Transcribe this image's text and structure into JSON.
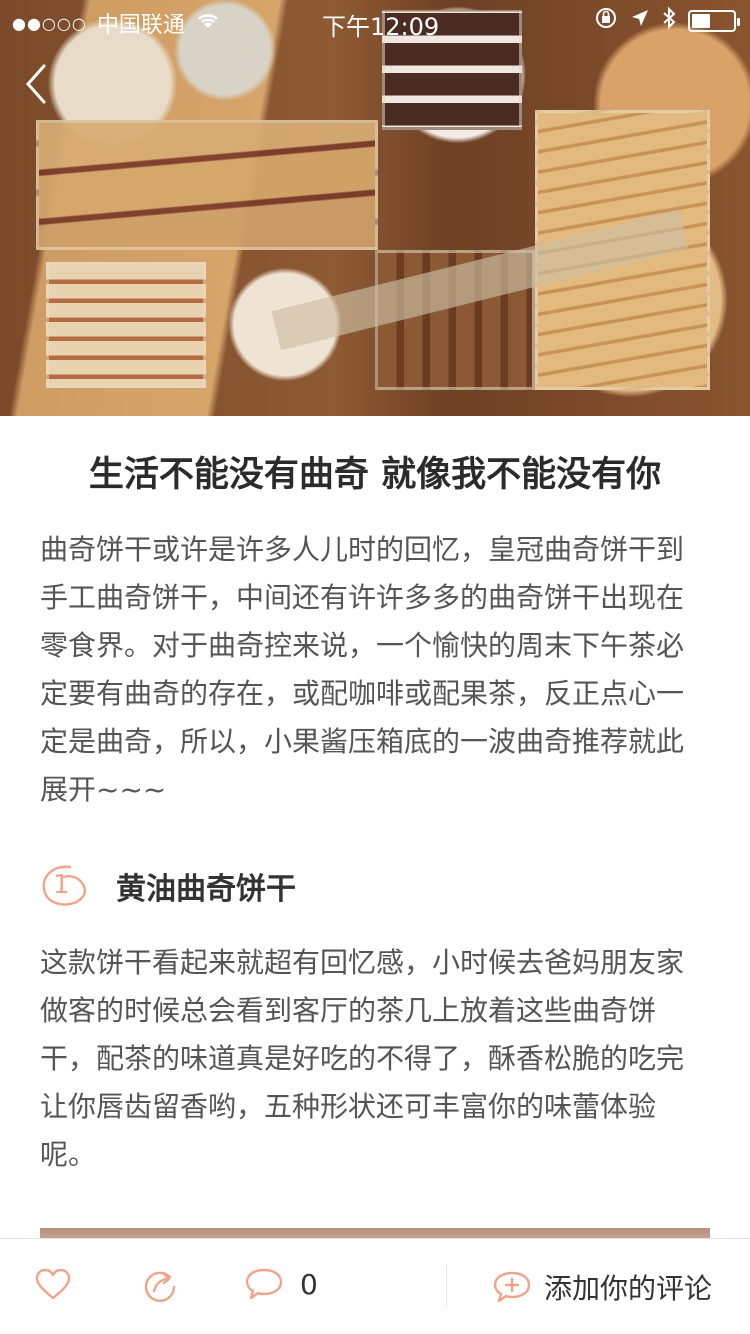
{
  "status_bar": {
    "signal": "●●○○○",
    "carrier": "中国联通",
    "time": "下午12:09",
    "battery_level": 0.45
  },
  "article": {
    "title": "生活不能没有曲奇 就像我不能没有你",
    "intro": "曲奇饼干或许是许多人儿时的回忆，皇冠曲奇饼干到手工曲奇饼干，中间还有许许多多的曲奇饼干出现在零食界。对于曲奇控来说，一个愉快的周末下午茶必定要有曲奇的存在，或配咖啡或配果茶，反正点心一定是曲奇，所以，小果酱压箱底的一波曲奇推荐就此展开~~~",
    "section_1": {
      "number": "1",
      "heading": "黄油曲奇饼干",
      "body": "这款饼干看起来就超有回忆感，小时候去爸妈朋友家做客的时候总会看到客厅的茶几上放着这些曲奇饼干，配茶的味道真是好吃的不得了，酥香松脆的吃完让你唇齿留香哟，五种形状还可丰富你的味蕾体验呢。"
    }
  },
  "toolbar": {
    "comment_count": "0",
    "add_comment_label": "添加你的评论"
  },
  "icons": {
    "back": "chevron-left-icon",
    "like": "heart-icon",
    "share": "share-icon",
    "comment": "speech-bubble-icon",
    "add_comment": "add-comment-icon"
  },
  "colors": {
    "accent": "#f0a58a",
    "title_text": "#2b2b2b",
    "body_text": "#555555"
  }
}
